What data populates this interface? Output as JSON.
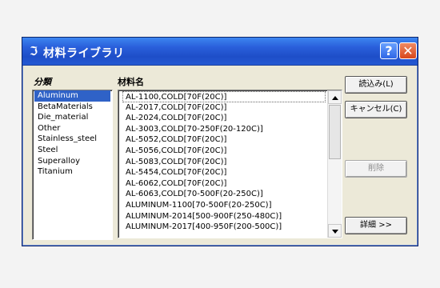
{
  "window": {
    "title": "材料ライブラリ",
    "help_icon": "help-icon",
    "close_icon": "close-icon",
    "app_icon": "app-icon"
  },
  "labels": {
    "category": "分類",
    "material_name": "材料名"
  },
  "categories": [
    {
      "label": "Aluminum",
      "selected": true
    },
    {
      "label": "BetaMaterials",
      "selected": false
    },
    {
      "label": "Die_material",
      "selected": false
    },
    {
      "label": "Other",
      "selected": false
    },
    {
      "label": "Stainless_steel",
      "selected": false
    },
    {
      "label": "Steel",
      "selected": false
    },
    {
      "label": "Superalloy",
      "selected": false
    },
    {
      "label": "Titanium",
      "selected": false
    }
  ],
  "materials": [
    "AL-1100,COLD[70F(20C)]",
    "AL-2017,COLD[70F(20C)]",
    "AL-2024,COLD[70F(20C)]",
    "AL-3003,COLD[70-250F(20-120C)]",
    "AL-5052,COLD[70F(20C)]",
    "AL-5056,COLD[70F(20C)]",
    "AL-5083,COLD[70F(20C)]",
    "AL-5454,COLD[70F(20C)]",
    "AL-6062,COLD[70F(20C)]",
    "AL-6063,COLD[70-500F(20-250C)]",
    "ALUMINUM-1100[70-500F(20-250C)]",
    "ALUMINUM-2014[500-900F(250-480C)]",
    "ALUMINUM-2017[400-950F(200-500C)]"
  ],
  "buttons": {
    "load": "読込み(L)",
    "cancel": "キャンセル(C)",
    "delete": "削除",
    "details": "詳細 >>"
  },
  "colors": {
    "titlebar": "#245edb",
    "window_bg": "#ece9d8",
    "selected_bg": "#2f62c7",
    "close_btn": "#d8471b",
    "help_btn": "#2f66e6"
  }
}
